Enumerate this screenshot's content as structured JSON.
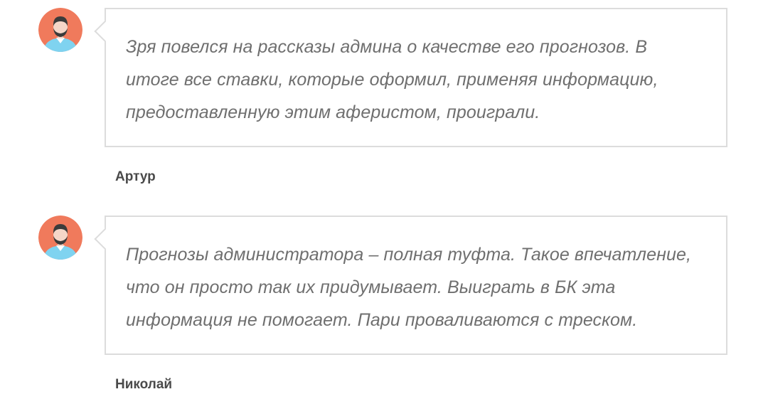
{
  "reviews": [
    {
      "avatar_icon": "user-avatar-icon",
      "text": "Зря повелся на рассказы админа о качестве его прогнозов. В итоге все ставки, которые оформил, применяя информацию, предоставленную этим аферистом, проиграли.",
      "author": "Артур"
    },
    {
      "avatar_icon": "user-avatar-icon",
      "text": "Прогнозы администратора – полная туфта. Такое впечатление, что он просто так их придумывает. Выиграть в БК эта информация не помогает. Пари проваливаются с треском.",
      "author": "Николай"
    }
  ],
  "colors": {
    "avatar_bg": "#f07a5c",
    "avatar_shirt": "#7fd3f0",
    "avatar_skin": "#f5d6c8",
    "avatar_hair": "#3b3b3b",
    "bubble_border": "#dcdcdc",
    "text": "#6f6f6f",
    "author": "#4a4a4a"
  }
}
